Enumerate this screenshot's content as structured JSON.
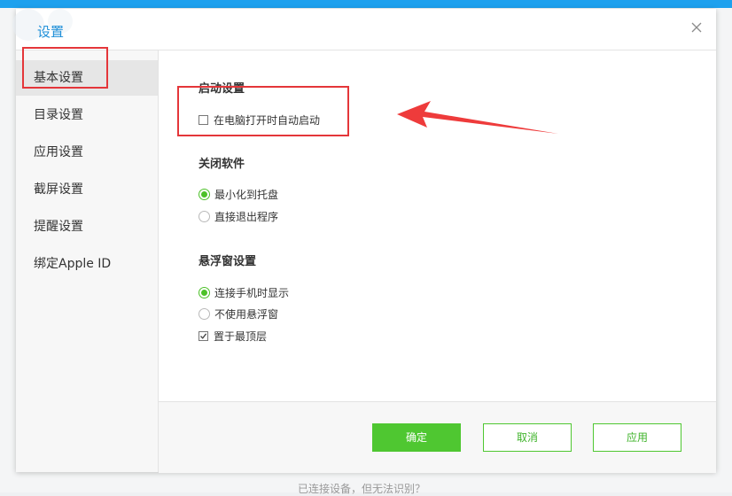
{
  "dialog": {
    "title": "设置"
  },
  "sidebar": {
    "items": [
      {
        "label": "基本设置",
        "active": true
      },
      {
        "label": "目录设置"
      },
      {
        "label": "应用设置"
      },
      {
        "label": "截屏设置"
      },
      {
        "label": "提醒设置"
      },
      {
        "label": "绑定Apple ID"
      }
    ]
  },
  "sections": {
    "startup": {
      "title": "启动设置",
      "options": [
        {
          "label": "在电脑打开时自动启动",
          "checked": false
        }
      ]
    },
    "close": {
      "title": "关闭软件",
      "options": [
        {
          "label": "最小化到托盘",
          "selected": true
        },
        {
          "label": "直接退出程序",
          "selected": false
        }
      ]
    },
    "float": {
      "title": "悬浮窗设置",
      "options": [
        {
          "label": "连接手机时显示",
          "selected": true
        },
        {
          "label": "不使用悬浮窗",
          "selected": false
        },
        {
          "label": "置于最顶层",
          "checked": true
        }
      ]
    }
  },
  "buttons": {
    "confirm": "确定",
    "cancel": "取消",
    "apply": "应用"
  },
  "footer": {
    "partial_text": "已连接设备，但无法识别？"
  },
  "colors": {
    "accent": "#1ea1ee",
    "green": "#4fc731",
    "annotation_red": "#e4363a"
  }
}
